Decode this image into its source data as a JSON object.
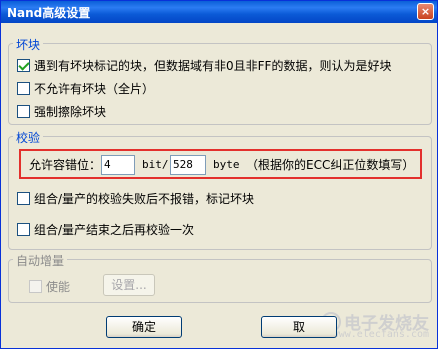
{
  "window": {
    "title": "Nand高级设置",
    "close_glyph": "×"
  },
  "bad_block": {
    "legend": "坏块",
    "options": [
      {
        "label": "遇到有坏块标记的块，但数据域有非0且非FF的数据，则认为是好块",
        "checked": true
      },
      {
        "label": "不允许有坏块（全片）",
        "checked": false
      },
      {
        "label": "强制擦除坏块",
        "checked": false
      }
    ]
  },
  "verify": {
    "legend": "校验",
    "tolerance_label": "允许容错位：",
    "bits_value": "4",
    "bit_unit": "bit/",
    "bytes_value": "528",
    "byte_unit": "byte",
    "hint": "（根据你的ECC纠正位数填写）",
    "options": [
      {
        "label": "组合/量产的校验失败后不报错，标记坏块",
        "checked": false
      },
      {
        "label": "组合/量产结束之后再校验一次",
        "checked": false
      }
    ]
  },
  "auto_increment": {
    "legend": "自动增量",
    "enable_label": "使能",
    "enabled": false,
    "settings_label": "设置..."
  },
  "buttons": {
    "ok": "确定",
    "cancel": "取"
  },
  "watermark": {
    "title": "电子发烧友",
    "subtitle": "www.elecfans.com"
  },
  "colors": {
    "titlebar": "#0a5fd8",
    "legend": "#0046d5",
    "highlight_box": "#e3302c"
  },
  "icons": {
    "close": "close-icon",
    "check": "check-icon"
  }
}
